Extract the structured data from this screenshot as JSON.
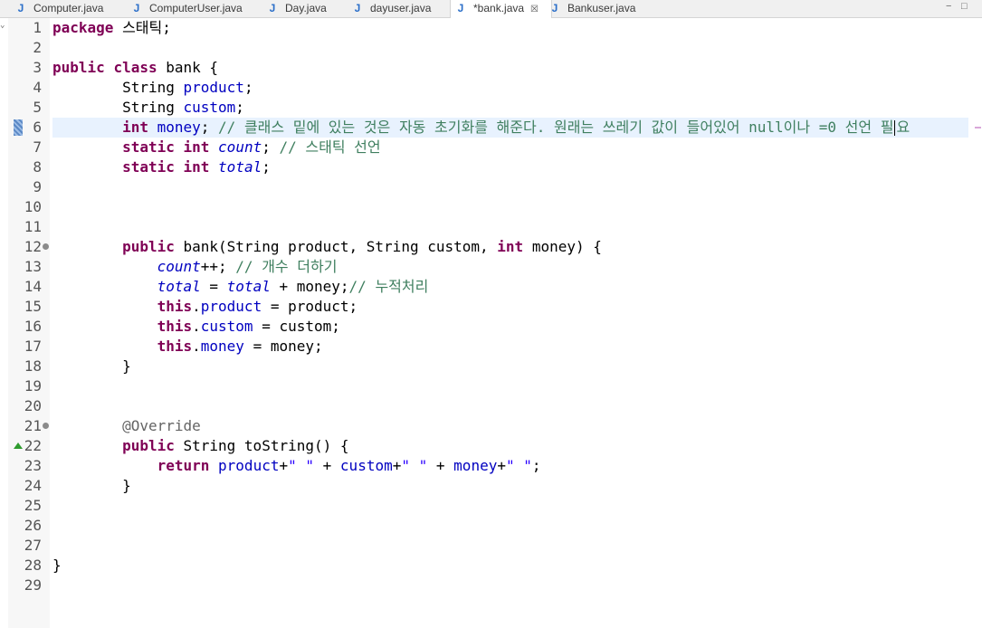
{
  "tabs": [
    {
      "label": "Computer.java",
      "active": false,
      "dirty": false
    },
    {
      "label": "ComputerUser.java",
      "active": false,
      "dirty": false
    },
    {
      "label": "Day.java",
      "active": false,
      "dirty": false
    },
    {
      "label": "dayuser.java",
      "active": false,
      "dirty": false
    },
    {
      "label": "*bank.java",
      "active": true,
      "dirty": true
    },
    {
      "label": "Bankuser.java",
      "active": false,
      "dirty": false
    }
  ],
  "tab_icon_glyph": "J",
  "close_glyph": "☒",
  "window_controls": {
    "minimize": "−",
    "maximize": "□"
  },
  "editor": {
    "current_line": 6,
    "cursor_after_text": "필",
    "fold_lines": [
      12,
      21
    ],
    "override_marker_line": 22,
    "change_marker_line": 6,
    "lines": [
      {
        "n": "1",
        "tokens": [
          [
            "kw",
            "package"
          ],
          [
            "txt",
            " 스태틱;"
          ]
        ]
      },
      {
        "n": "2",
        "tokens": []
      },
      {
        "n": "3",
        "tokens": [
          [
            "kw",
            "public"
          ],
          [
            "txt",
            " "
          ],
          [
            "kw",
            "class"
          ],
          [
            "txt",
            " bank {"
          ]
        ]
      },
      {
        "n": "4",
        "tokens": [
          [
            "txt",
            "        String "
          ],
          [
            "fld",
            "product"
          ],
          [
            "txt",
            ";"
          ]
        ]
      },
      {
        "n": "5",
        "tokens": [
          [
            "txt",
            "        String "
          ],
          [
            "fld",
            "custom"
          ],
          [
            "txt",
            ";"
          ]
        ]
      },
      {
        "n": "6",
        "tokens": [
          [
            "txt",
            "        "
          ],
          [
            "kw",
            "int"
          ],
          [
            "txt",
            " "
          ],
          [
            "fld",
            "money"
          ],
          [
            "txt",
            "; "
          ],
          [
            "cmt",
            "// 클래스 밑에 있는 것은 자동 초기화를 해준다. 원래는 쓰레기 값이 들어있어 null이나 =0 선언 필"
          ],
          [
            "cursor",
            ""
          ],
          [
            "cmt",
            "요"
          ]
        ]
      },
      {
        "n": "7",
        "tokens": [
          [
            "txt",
            "        "
          ],
          [
            "kw",
            "static"
          ],
          [
            "txt",
            " "
          ],
          [
            "kw",
            "int"
          ],
          [
            "txt",
            " "
          ],
          [
            "sfld",
            "count"
          ],
          [
            "txt",
            "; "
          ],
          [
            "cmt",
            "// 스태틱 선언"
          ]
        ]
      },
      {
        "n": "8",
        "tokens": [
          [
            "txt",
            "        "
          ],
          [
            "kw",
            "static"
          ],
          [
            "txt",
            " "
          ],
          [
            "kw",
            "int"
          ],
          [
            "txt",
            " "
          ],
          [
            "sfld",
            "total"
          ],
          [
            "txt",
            ";"
          ]
        ]
      },
      {
        "n": "9",
        "tokens": []
      },
      {
        "n": "10",
        "tokens": []
      },
      {
        "n": "11",
        "tokens": []
      },
      {
        "n": "12",
        "tokens": [
          [
            "txt",
            "        "
          ],
          [
            "kw",
            "public"
          ],
          [
            "txt",
            " bank(String product, String custom, "
          ],
          [
            "kw",
            "int"
          ],
          [
            "txt",
            " money) {"
          ]
        ]
      },
      {
        "n": "13",
        "tokens": [
          [
            "txt",
            "            "
          ],
          [
            "sfld",
            "count"
          ],
          [
            "txt",
            "++; "
          ],
          [
            "cmt",
            "// 개수 더하기"
          ]
        ]
      },
      {
        "n": "14",
        "tokens": [
          [
            "txt",
            "            "
          ],
          [
            "sfld",
            "total"
          ],
          [
            "txt",
            " = "
          ],
          [
            "sfld",
            "total"
          ],
          [
            "txt",
            " + money;"
          ],
          [
            "cmt",
            "// 누적처리"
          ]
        ]
      },
      {
        "n": "15",
        "tokens": [
          [
            "txt",
            "            "
          ],
          [
            "kw",
            "this"
          ],
          [
            "txt",
            "."
          ],
          [
            "fld",
            "product"
          ],
          [
            "txt",
            " = product;"
          ]
        ]
      },
      {
        "n": "16",
        "tokens": [
          [
            "txt",
            "            "
          ],
          [
            "kw",
            "this"
          ],
          [
            "txt",
            "."
          ],
          [
            "fld",
            "custom"
          ],
          [
            "txt",
            " = custom;"
          ]
        ]
      },
      {
        "n": "17",
        "tokens": [
          [
            "txt",
            "            "
          ],
          [
            "kw",
            "this"
          ],
          [
            "txt",
            "."
          ],
          [
            "fld",
            "money"
          ],
          [
            "txt",
            " = money;"
          ]
        ]
      },
      {
        "n": "18",
        "tokens": [
          [
            "txt",
            "        }"
          ]
        ]
      },
      {
        "n": "19",
        "tokens": []
      },
      {
        "n": "20",
        "tokens": []
      },
      {
        "n": "21",
        "tokens": [
          [
            "txt",
            "        "
          ],
          [
            "ann",
            "@Override"
          ]
        ]
      },
      {
        "n": "22",
        "tokens": [
          [
            "txt",
            "        "
          ],
          [
            "kw",
            "public"
          ],
          [
            "txt",
            " String toString() {"
          ]
        ]
      },
      {
        "n": "23",
        "tokens": [
          [
            "txt",
            "            "
          ],
          [
            "kw",
            "return"
          ],
          [
            "txt",
            " "
          ],
          [
            "fld",
            "product"
          ],
          [
            "txt",
            "+"
          ],
          [
            "str",
            "\" \""
          ],
          [
            "txt",
            " + "
          ],
          [
            "fld",
            "custom"
          ],
          [
            "txt",
            "+"
          ],
          [
            "str",
            "\" \""
          ],
          [
            "txt",
            " + "
          ],
          [
            "fld",
            "money"
          ],
          [
            "txt",
            "+"
          ],
          [
            "str",
            "\" \""
          ],
          [
            "txt",
            ";"
          ]
        ]
      },
      {
        "n": "24",
        "tokens": [
          [
            "txt",
            "        }"
          ]
        ]
      },
      {
        "n": "25",
        "tokens": []
      },
      {
        "n": "26",
        "tokens": []
      },
      {
        "n": "27",
        "tokens": []
      },
      {
        "n": "28",
        "tokens": [
          [
            "txt",
            "}"
          ]
        ]
      },
      {
        "n": "29",
        "tokens": []
      }
    ]
  }
}
